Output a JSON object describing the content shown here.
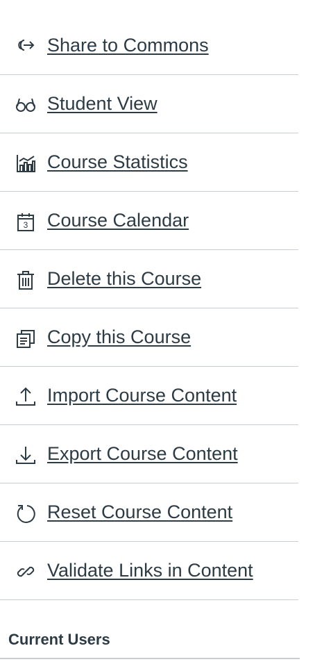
{
  "menu": {
    "items": [
      {
        "label": " Share to Commons",
        "icon": "share-icon"
      },
      {
        "label": "Student View",
        "icon": "glasses-icon"
      },
      {
        "label": "Course Statistics",
        "icon": "stats-icon"
      },
      {
        "label": "Course Calendar",
        "icon": "calendar-icon"
      },
      {
        "label": "Delete this Course",
        "icon": "trash-icon"
      },
      {
        "label": "Copy this Course",
        "icon": "copy-icon"
      },
      {
        "label": "Import Course Content",
        "icon": "upload-icon"
      },
      {
        "label": "Export Course Content",
        "icon": "download-icon"
      },
      {
        "label": "Reset Course Content",
        "icon": "reset-icon"
      },
      {
        "label": "Validate Links in Content",
        "icon": "link-icon"
      }
    ]
  },
  "calendar_icon_day": "3",
  "current_users": {
    "title": "Current Users"
  }
}
